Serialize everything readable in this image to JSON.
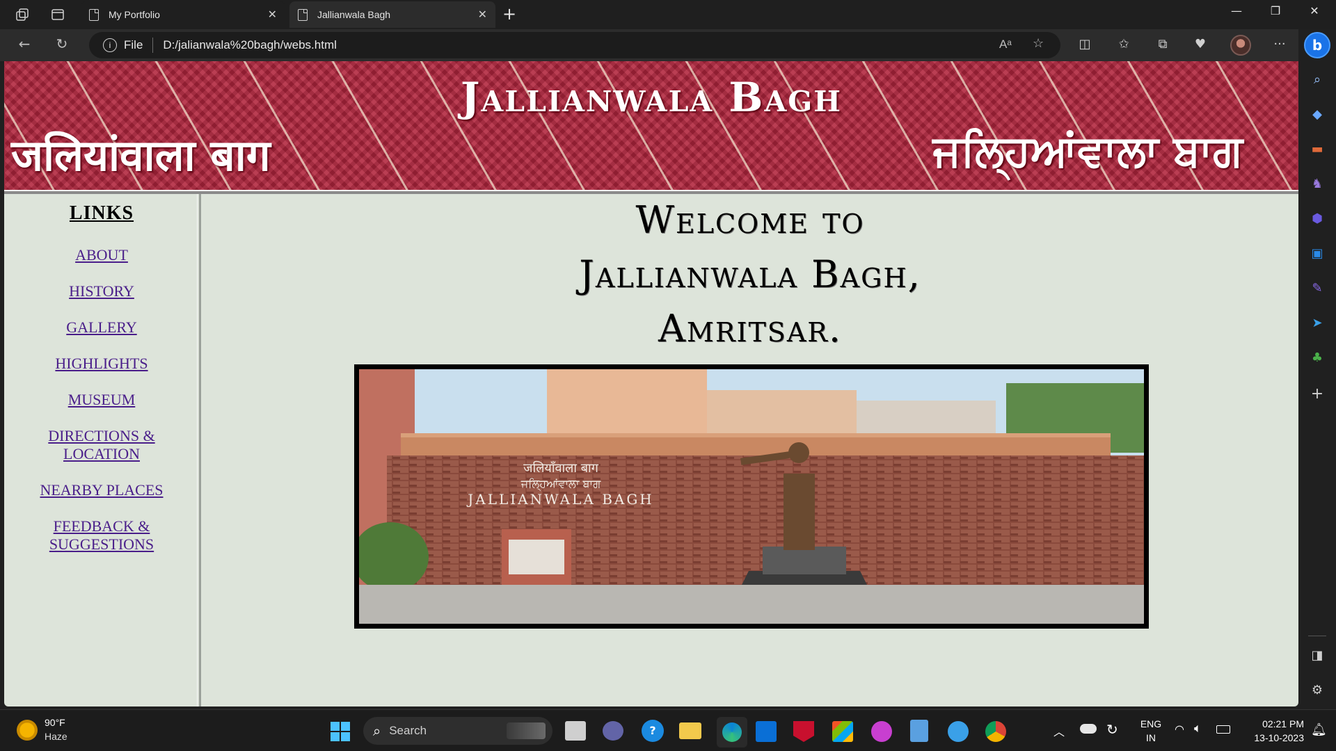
{
  "browser": {
    "tabs": [
      {
        "title": "My Portfolio",
        "active": false
      },
      {
        "title": "Jallianwala Bagh",
        "active": true
      }
    ],
    "address": {
      "scheme_label": "File",
      "url": "D:/jalianwala%20bagh/webs.html"
    }
  },
  "banner": {
    "title": "Jallianwala Bagh",
    "hindi": "जलियांवाला बाग",
    "punjabi": "ਜਲ੍ਹਿਆਂਵਾਲਾ ਬਾਗ"
  },
  "nav": {
    "heading": "LINKS",
    "links": [
      "ABOUT",
      "HISTORY",
      "GALLERY",
      "HIGHLIGHTS",
      "MUSEUM",
      "DIRECTIONS & LOCATION",
      "NEARBY PLACES",
      "FEEDBACK & SUGGESTIONS"
    ]
  },
  "main": {
    "welcome_lines": [
      "Welcome to",
      "Jallianwala Bagh,",
      "Amritsar."
    ],
    "photo_sign": {
      "hindi": "जलियाँवाला  बाग",
      "punjabi": "ਜਲ੍ਹਿਆਂਵਾਲਾ  ਬਾਗ",
      "english": "JALLIANWALA  BAGH"
    }
  },
  "taskbar": {
    "weather_temp": "90°F",
    "weather_desc": "Haze",
    "search_placeholder": "Search",
    "lang_top": "ENG",
    "lang_bottom": "IN",
    "time": "02:21 PM",
    "date": "13-10-2023"
  },
  "colors": {
    "banner": "#b1253d",
    "page_bg": "#dde4da",
    "link": "#4a1e8a",
    "edge_blue": "#1a73e8"
  }
}
